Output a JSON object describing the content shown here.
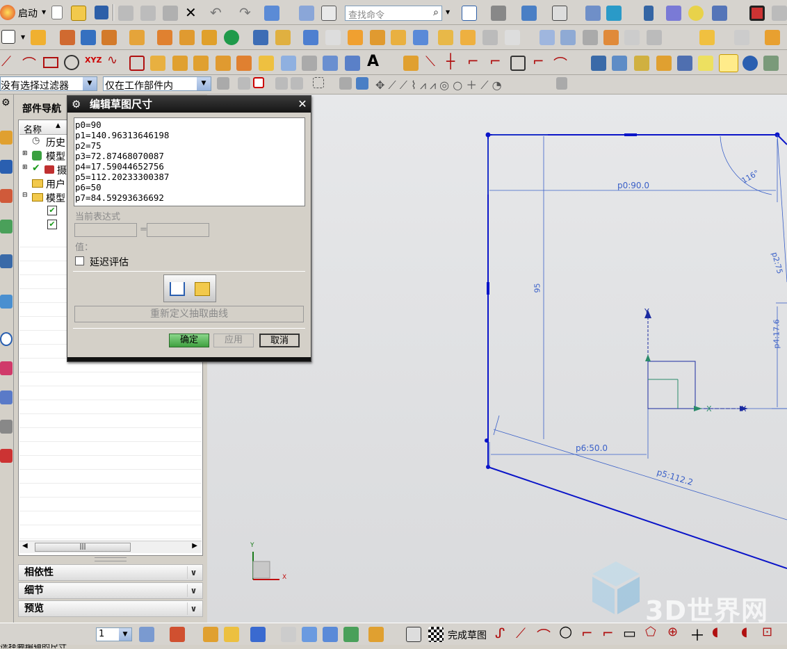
{
  "toolbar": {
    "start_label": "启动",
    "search_placeholder": "查找命令",
    "filter_select": "没有选择过滤器",
    "scope_select": "仅在工作部件内"
  },
  "navigator": {
    "title": "部件导航",
    "column_name": "名称",
    "tree_items": [
      "历史",
      "模型",
      "摄",
      "用户",
      "模型"
    ],
    "sections": [
      "相依性",
      "细节",
      "预览"
    ]
  },
  "dialog": {
    "title": "编辑草图尺寸",
    "expressions": [
      "p0=90",
      "p1=140.96313646198",
      "p2=75",
      "p3=72.87468070087",
      "p4=17.59044652756",
      "p5=112.20233300387",
      "p6=50",
      "p7=84.59293636692"
    ],
    "current_expr_label": "当前表达式",
    "equals": "=",
    "value_label": "值：",
    "delay_label": "延迟评估",
    "redefine_label": "重新定义抽取曲线",
    "ok_label": "确定",
    "apply_label": "应用",
    "cancel_label": "取消"
  },
  "sketch": {
    "dim_p0": "p0:90.0",
    "dim_angle": "116°",
    "dim_95": "95",
    "dim_p2": "p2:75",
    "dim_p4": "p4:17.6",
    "dim_p6": "p6:50.0",
    "dim_p5": "p5:112.2",
    "axis_y": "Y",
    "axis_x": "X",
    "triad_x": "X",
    "triad_y": "Y"
  },
  "bottom": {
    "layer_value": "1",
    "finish_sketch_label": "完成草图"
  },
  "watermark": "3D世界网",
  "status_text": "选择要编辑的尺寸"
}
